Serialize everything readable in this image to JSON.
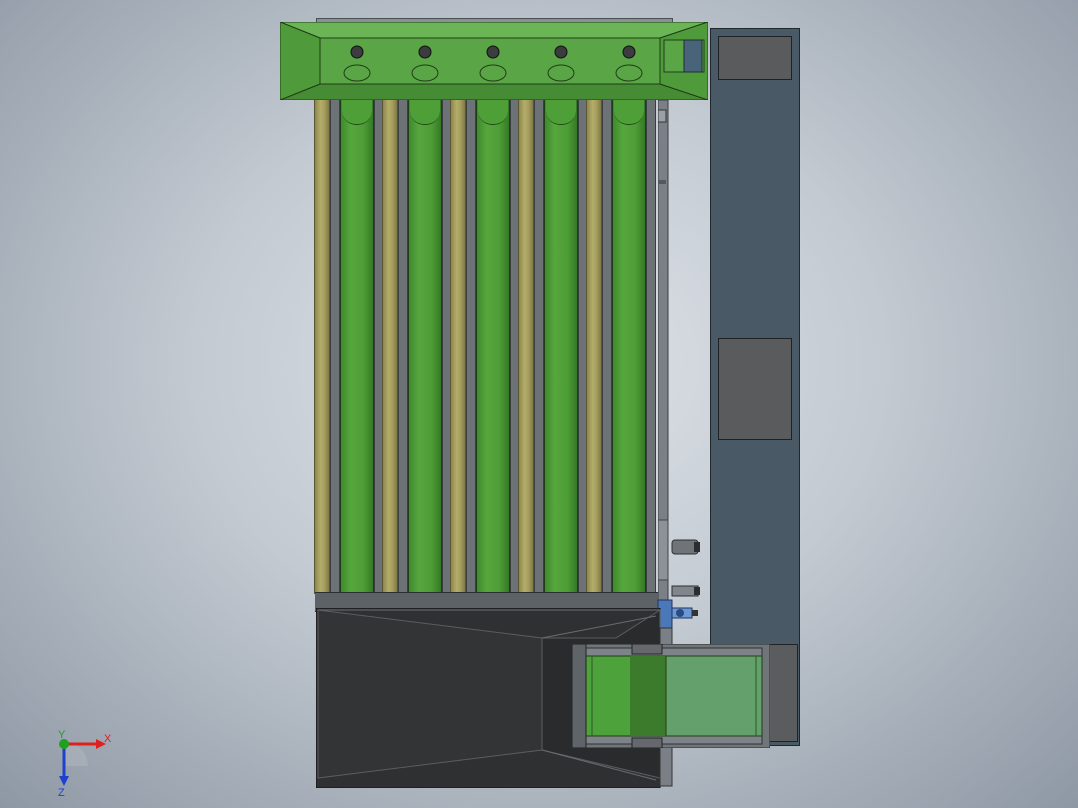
{
  "viewport": {
    "background": "gradient-grey",
    "model": {
      "hopper": {
        "holes": 5,
        "color": "#5aa545"
      },
      "lanes": 5,
      "rods": 5,
      "colors": {
        "green": "#4e9d37",
        "rod": "#a39c5d",
        "panel": "#4a5966",
        "chute": "#2f3032",
        "conveyor": "#64a06c"
      }
    }
  },
  "triad": {
    "x_label": "X",
    "y_label": "Y",
    "z_label": "Z",
    "colors": {
      "x": "#e02020",
      "y": "#20a020",
      "z": "#2040d0"
    }
  }
}
